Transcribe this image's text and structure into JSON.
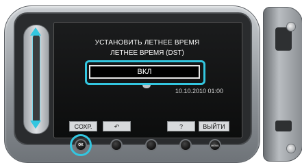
{
  "screen": {
    "title": "УСТАНОВИТЬ ЛЕТНЕЕ ВРЕМЯ",
    "subtitle": "ЛЕТНЕЕ ВРЕМЯ (DST)",
    "selected_option": "ВКЛ",
    "datetime": "10.10.2010 01:00"
  },
  "softkeys": {
    "save_label": "СОХР.",
    "back_symbol": "↶",
    "help_label": "?",
    "exit_label": "ВЫЙТИ"
  },
  "buttons": {
    "ok_label": "OK",
    "menu_label": "MENU"
  },
  "colors": {
    "accent": "#33c6e0",
    "screen_bg": "#111213",
    "body": "#9a9ea2"
  },
  "icons": [
    "slider-up-arrow-icon",
    "slider-down-arrow-icon",
    "back-arrow-icon"
  ]
}
